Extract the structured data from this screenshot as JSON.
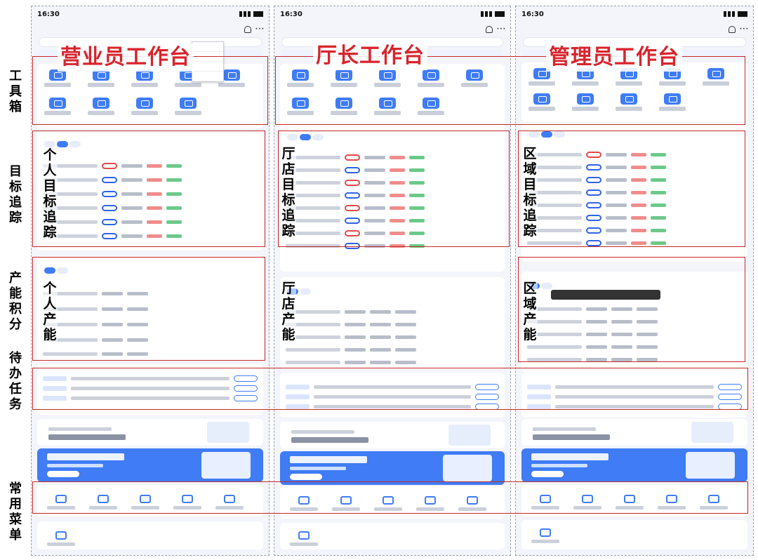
{
  "side_labels": {
    "toolbox": "工具箱",
    "target": "目标追踪",
    "production": "产能积分",
    "todo": "待办任务",
    "menu": "常用菜单"
  },
  "columns": [
    {
      "title": "营业员工作台",
      "time": "16:30",
      "target_label": "个人目标追踪",
      "production_label": "个人产能"
    },
    {
      "title": "厅长工作台",
      "time": "16:30",
      "target_label": "厅店目标追踪",
      "production_label": "厅店产能"
    },
    {
      "title": "管理员工作台",
      "time": "16:30",
      "target_label": "区域目标追踪",
      "production_label": "区域产能"
    }
  ],
  "colors": {
    "accent": "#3f7cf5",
    "frame": "#c62828",
    "title": "#d8242c"
  }
}
